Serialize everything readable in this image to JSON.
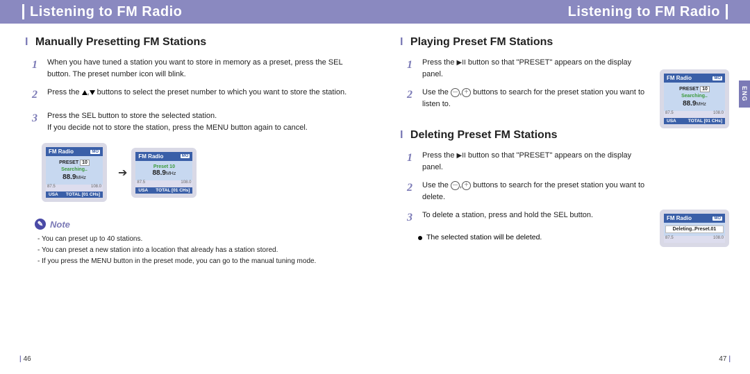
{
  "header_left": "Listening to FM Radio",
  "header_right": "Listening to FM Radio",
  "lang_tab": "ENG",
  "page_left_num": "46",
  "page_right_num": "47",
  "left": {
    "section1_title": "Manually Presetting FM Stations",
    "s1_step1": "When you have tuned a station you want to store in memory as a preset, press the SEL button. The preset number icon will blink.",
    "s1_step2_a": "Press the ",
    "s1_step2_b": " buttons to select the preset number to which you want to store the station.",
    "s1_step3": "Press the SEL button to store the selected station.",
    "s1_step3_sub": "If you decide not to store the station, press the MENU button again to cancel.",
    "note_label": "Note",
    "note1": "You can preset up to 40 stations.",
    "note2": "You can preset a new station into a location that already has a station stored.",
    "note3": "If you press the MENU button in the preset mode, you can go to the manual tuning mode."
  },
  "right": {
    "section2_title": "Playing Preset FM Stations",
    "s2_step1_a": "Press the ",
    "s2_step1_b": " button so that \"PRESET\" appears on the display panel.",
    "s2_step2_a": "Use the ",
    "s2_step2_b": " buttons to search for the preset station you want to listen to.",
    "section3_title": "Deleting Preset FM Stations",
    "s3_step1_a": "Press the ",
    "s3_step1_b": " button so that \"PRESET\" appears on the display panel.",
    "s3_step2_a": "Use the ",
    "s3_step2_b": " buttons to search for the preset station you want to delete.",
    "s3_step3": "To delete a station, press and hold the SEL button.",
    "s3_bullet": "The selected station will be deleted."
  },
  "device": {
    "title": "FM Radio",
    "mo": "MO",
    "preset_label": "PRESET",
    "preset_num": "10",
    "searching": "Searching..",
    "preset10": "Preset 10",
    "freq": "88.9",
    "mhz": "MHz",
    "tick_l": "87.5",
    "tick_r": "108.0",
    "usa": "USA",
    "total": "TOTAL [01 CHs]",
    "deleting": "Deleting..Preset.01"
  },
  "icons": {
    "play_pause": "▶II",
    "minus": "—",
    "plus": "＋",
    "comma": ","
  }
}
